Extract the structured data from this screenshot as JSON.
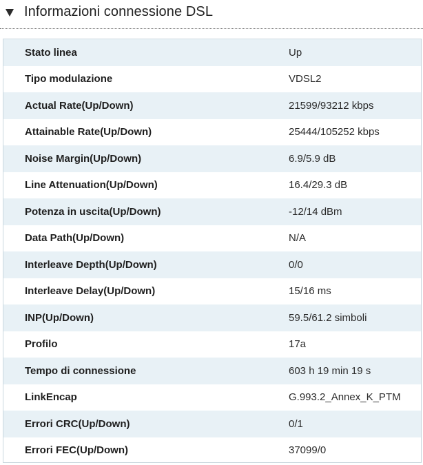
{
  "section": {
    "title": "Informazioni connessione DSL",
    "toggle_icon": "collapse-triangle-icon"
  },
  "rows": [
    {
      "label": "Stato linea",
      "value": "Up"
    },
    {
      "label": "Tipo modulazione",
      "value": "VDSL2"
    },
    {
      "label": "Actual Rate(Up/Down)",
      "value": "21599/93212 kbps"
    },
    {
      "label": "Attainable Rate(Up/Down)",
      "value": "25444/105252 kbps"
    },
    {
      "label": "Noise Margin(Up/Down)",
      "value": "6.9/5.9 dB"
    },
    {
      "label": "Line Attenuation(Up/Down)",
      "value": "16.4/29.3 dB"
    },
    {
      "label": "Potenza in uscita(Up/Down)",
      "value": "-12/14 dBm"
    },
    {
      "label": "Data Path(Up/Down)",
      "value": "N/A"
    },
    {
      "label": "Interleave Depth(Up/Down)",
      "value": "0/0"
    },
    {
      "label": "Interleave Delay(Up/Down)",
      "value": "15/16 ms"
    },
    {
      "label": "INP(Up/Down)",
      "value": "59.5/61.2 simboli"
    },
    {
      "label": "Profilo",
      "value": "17a"
    },
    {
      "label": "Tempo di connessione",
      "value": "603 h 19 min 19 s"
    },
    {
      "label": "LinkEncap",
      "value": "G.993.2_Annex_K_PTM"
    },
    {
      "label": "Errori CRC(Up/Down)",
      "value": "0/1"
    },
    {
      "label": "Errori FEC(Up/Down)",
      "value": "37099/0"
    }
  ],
  "colors": {
    "row_shade": "#e8f1f6",
    "border": "#c9d6dd",
    "text": "#1f1f1f"
  }
}
